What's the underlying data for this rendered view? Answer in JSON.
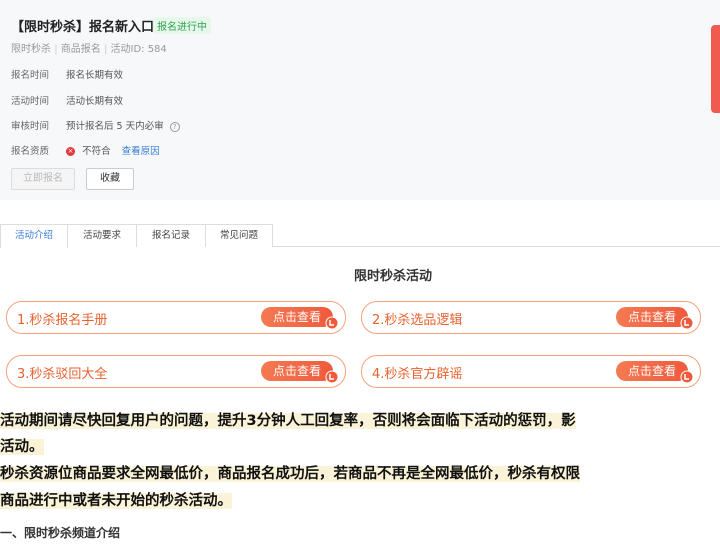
{
  "header": {
    "title": "【限时秒杀】报名新入口",
    "badge": "报名进行中",
    "meta": {
      "a": "限时秒杀",
      "b": "商品报名",
      "c": "活动ID: 584"
    },
    "rows": [
      {
        "label": "报名时间",
        "value": "报名长期有效"
      },
      {
        "label": "活动时间",
        "value": "活动长期有效"
      },
      {
        "label": "审核时间",
        "value": "预计报名后 5 天内必审"
      },
      {
        "label": "报名资质",
        "value": "不符合",
        "link": "查看原因"
      }
    ],
    "buttons": {
      "apply": "立即报名",
      "favorite": "收藏"
    }
  },
  "tabs": [
    "活动介绍",
    "活动要求",
    "报名记录",
    "常见问题"
  ],
  "section_title": "限时秒杀活动",
  "pills": [
    {
      "label": "1.秒杀报名手册",
      "button": "点击查看"
    },
    {
      "label": "2.秒杀选品逻辑",
      "button": "点击查看"
    },
    {
      "label": "3.秒杀驳回大全",
      "button": "点击查看"
    },
    {
      "label": "4.秒杀官方辟谣",
      "button": "点击查看"
    }
  ],
  "notices": [
    "活动期间请尽快回复用户的问题，提升3分钟人工回复率，否则将会面临下活动的惩罚，影",
    "活动。",
    "秒杀资源位商品要求全网最低价，商品报名成功后，若商品不再是全网最低价，秒杀有权限",
    "商品进行中或者未开始的秒杀活动。"
  ],
  "heading_1": "一、限时秒杀频道介绍",
  "colors": {
    "accent_orange": "#f05a3c",
    "link_blue": "#3a7bd5",
    "badge_green": "#2ea44f",
    "highlight": "#fbf3d8"
  }
}
